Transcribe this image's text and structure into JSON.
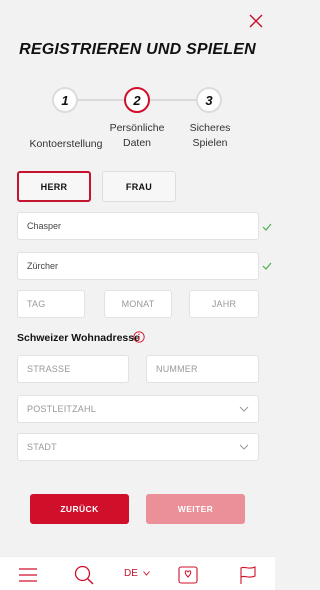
{
  "header": {
    "title": "REGISTRIEREN UND SPIELEN"
  },
  "steps": [
    {
      "number": "1",
      "label_line1": "Kontoerstellung",
      "label_line2": "",
      "active": false
    },
    {
      "number": "2",
      "label_line1": "Persönliche",
      "label_line2": "Daten",
      "active": true
    },
    {
      "number": "3",
      "label_line1": "Sicheres",
      "label_line2": "Spielen",
      "active": false
    }
  ],
  "gender": {
    "male": "HERR",
    "female": "FRAU",
    "selected": "male"
  },
  "form": {
    "first_name": "Chasper",
    "last_name": "Zürcher",
    "day_placeholder": "TAG",
    "month_placeholder": "MONAT",
    "year_placeholder": "JAHR",
    "address_title": "Schweizer Wohnadresse",
    "street_placeholder": "STRASSE",
    "number_placeholder": "NUMMER",
    "postal_placeholder": "POSTLEITZAHL",
    "city_placeholder": "STADT"
  },
  "actions": {
    "back": "ZURÜCK",
    "next": "WEITER"
  },
  "bottom_nav": {
    "language": "DE"
  },
  "colors": {
    "accent": "#d0102a",
    "accent_disabled": "#eb8f99",
    "success": "#4caf50"
  },
  "icons": [
    "close-icon",
    "check-icon",
    "info-icon",
    "chevron-down-icon",
    "menu-icon",
    "search-icon",
    "cards-icon",
    "flag-icon"
  ]
}
